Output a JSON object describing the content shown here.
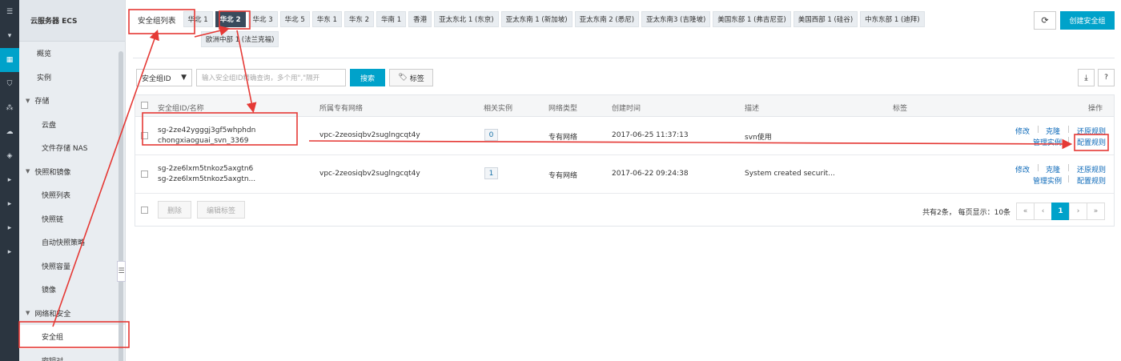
{
  "rail": {
    "icons": [
      "menu-icon",
      "chevron-down-icon",
      "server-icon",
      "shield-icon",
      "network-icon",
      "cloud-icon",
      "box-icon",
      "chevron-right-icon",
      "chevron-right-icon",
      "chevron-right-icon",
      "chevron-right-icon"
    ]
  },
  "sidebar": {
    "title": "云服务器 ECS",
    "items": [
      {
        "label": "概览",
        "type": "item"
      },
      {
        "label": "实例",
        "type": "item"
      },
      {
        "label": "存储",
        "type": "group"
      },
      {
        "label": "云盘",
        "type": "sub"
      },
      {
        "label": "文件存储 NAS",
        "type": "sub"
      },
      {
        "label": "快照和镜像",
        "type": "group"
      },
      {
        "label": "快照列表",
        "type": "sub"
      },
      {
        "label": "快照链",
        "type": "sub"
      },
      {
        "label": "自动快照策略",
        "type": "sub"
      },
      {
        "label": "快照容量",
        "type": "sub"
      },
      {
        "label": "镜像",
        "type": "sub"
      },
      {
        "label": "网络和安全",
        "type": "group"
      },
      {
        "label": "安全组",
        "type": "sub",
        "active": true
      },
      {
        "label": "密钥对",
        "type": "sub"
      }
    ]
  },
  "regions": {
    "list_title": "安全组列表",
    "tabs": [
      "华北 1",
      "华北 2",
      "华北 3",
      "华北 5",
      "华东 1",
      "华东 2",
      "华南 1",
      "香港",
      "亚太东北 1 (东京)",
      "亚太东南 1 (新加坡)",
      "亚太东南 2 (悉尼)",
      "亚太东南3 (吉隆坡)",
      "美国东部 1 (弗吉尼亚)",
      "美国西部 1 (硅谷)",
      "中东东部 1 (迪拜)",
      "欧洲中部 1 (法兰克福)"
    ],
    "selected": "华北 2"
  },
  "toolbar": {
    "refresh_icon": "refresh-icon",
    "create_label": "创建安全组",
    "filter_select": "安全组ID",
    "search_placeholder": "输入安全组ID精确查询，多个用\",\"隔开",
    "search_label": "搜索",
    "tag_label": "标签"
  },
  "table": {
    "headers": [
      "安全组ID/名称",
      "所属专有网络",
      "相关实例",
      "网络类型",
      "创建时间",
      "描述",
      "标签",
      "操作"
    ],
    "rows": [
      {
        "id": "sg-2ze42ygggj3gf5whphdn",
        "name": "chongxiaoguai_svn_3369",
        "vpc": "vpc-2zeosiqbv2suglngcqt4y",
        "instances": "0",
        "net_type": "专有网络",
        "created": "2017-06-25 11:37:13",
        "desc": "svn使用",
        "ops": [
          "修改",
          "克隆",
          "还原规则",
          "管理实例",
          "配置规则"
        ]
      },
      {
        "id": "sg-2ze6lxm5tnkoz5axgtn6",
        "name": "sg-2ze6lxm5tnkoz5axgtn...",
        "vpc": "vpc-2zeosiqbv2suglngcqt4y",
        "instances": "1",
        "net_type": "专有网络",
        "created": "2017-06-22 09:24:38",
        "desc": "System created securit...",
        "ops": [
          "修改",
          "克隆",
          "还原规则",
          "管理实例",
          "配置规则"
        ]
      }
    ],
    "footer": {
      "delete_label": "删除",
      "edit_tag_label": "编辑标签",
      "summary": "共有2条， 每页显示：10条",
      "pages": [
        "«",
        "‹",
        "1",
        "›",
        "»"
      ],
      "current_page": "1"
    }
  },
  "colors": {
    "accent": "#00a2ca",
    "annotation": "#e53935",
    "selected_tab": "#394b5c"
  }
}
